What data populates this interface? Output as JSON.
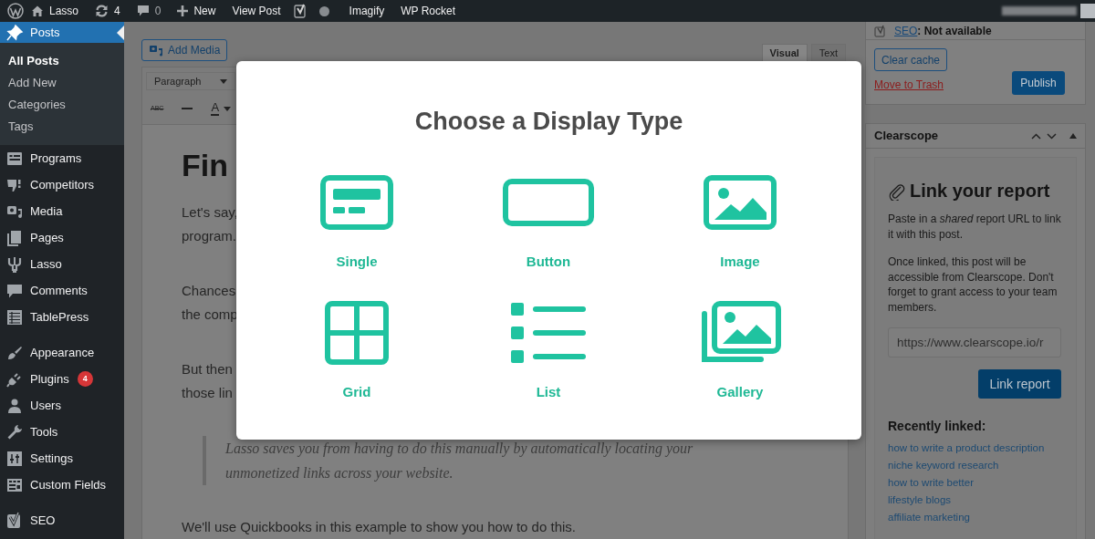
{
  "admin_bar": {
    "items": [
      {
        "label": "Lasso"
      },
      {
        "label": "4"
      },
      {
        "label": "0"
      },
      {
        "label": "New"
      },
      {
        "label": "View Post"
      },
      {
        "label": "Imagify"
      },
      {
        "label": "WP Rocket"
      }
    ]
  },
  "sidebar": {
    "groups": [
      {
        "items": [
          {
            "label": "Posts",
            "selected": true,
            "submenu": [
              {
                "label": "All Posts",
                "selected": true
              },
              {
                "label": "Add New",
                "selected": false
              },
              {
                "label": "Categories",
                "selected": false
              },
              {
                "label": "Tags",
                "selected": false
              }
            ]
          },
          {
            "label": "Programs",
            "selected": false
          },
          {
            "label": "Competitors",
            "selected": false
          },
          {
            "label": "Media",
            "selected": false
          },
          {
            "label": "Pages",
            "selected": false
          },
          {
            "label": "Lasso",
            "selected": false
          },
          {
            "label": "Comments",
            "selected": false
          },
          {
            "label": "TablePress",
            "selected": false
          }
        ]
      },
      {
        "items": [
          {
            "label": "Appearance",
            "selected": false
          },
          {
            "label": "Plugins",
            "selected": false,
            "badge": "4"
          },
          {
            "label": "Users",
            "selected": false
          },
          {
            "label": "Tools",
            "selected": false
          },
          {
            "label": "Settings",
            "selected": false
          },
          {
            "label": "Custom Fields",
            "selected": false
          }
        ]
      },
      {
        "items": [
          {
            "label": "SEO",
            "selected": false
          }
        ]
      }
    ]
  },
  "editor": {
    "add_media": "Add Media",
    "tabs": [
      {
        "label": "Visual",
        "selected": true
      },
      {
        "label": "Text",
        "selected": false
      }
    ],
    "format_select": "Paragraph",
    "toolbar": {
      "strikethrough": "ABC",
      "text_color": "A"
    },
    "heading": "Fin",
    "paragraphs": [
      [
        "Let's say,",
        "program."
      ],
      [
        "Chances",
        "the comp"
      ],
      [
        "But then",
        "those lin"
      ]
    ],
    "quote": "Lasso saves you from having to do this manually by automatically locating your unmonetized links across your website.",
    "last_paragraph": "We'll use Quickbooks in this example to show you how to do this."
  },
  "publish_box": {
    "seo_link": "SEO",
    "seo_text": ": Not available",
    "clear_cache": "Clear cache",
    "trash": "Move to Trash",
    "publish": "Publish"
  },
  "clearscope": {
    "title": "Clearscope",
    "heading": "Link your report",
    "intro": "Paste in a *shared* report URL to link it with this post.",
    "note": "Once linked, this post will be accessible from Clearscope. Don't forget to grant access to your team members.",
    "url_field": {
      "placeholder": "https://www.clearscope.io/r"
    },
    "link_button": "Link report",
    "recent_title": "Recently linked:",
    "recent": [
      "how to write a product description",
      "niche keyword research",
      "how to write better",
      "lifestyle blogs",
      "affiliate marketing"
    ]
  },
  "modal": {
    "title": "Choose a Display Type",
    "options": [
      {
        "label": "Single"
      },
      {
        "label": "Button"
      },
      {
        "label": "Image"
      },
      {
        "label": "Grid"
      },
      {
        "label": "List"
      },
      {
        "label": "Gallery"
      }
    ]
  }
}
